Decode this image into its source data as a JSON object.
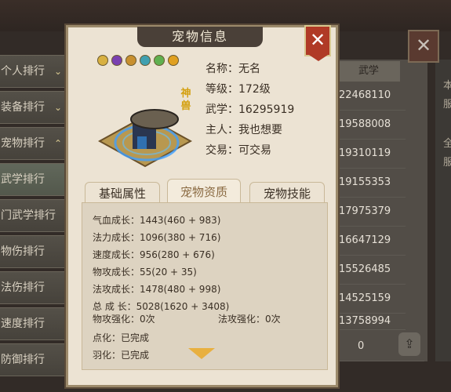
{
  "background_panel": {
    "ranking_items": [
      {
        "label": "个人排行",
        "chevron": "⌄"
      },
      {
        "label": "装备排行",
        "chevron": "⌄"
      },
      {
        "label": "宠物排行",
        "chevron": "⌃"
      },
      {
        "label": "武学排行",
        "chevron": ""
      },
      {
        "label": "门武学排行",
        "chevron": ""
      },
      {
        "label": "物伤排行",
        "chevron": ""
      },
      {
        "label": "法伤排行",
        "chevron": ""
      },
      {
        "label": "速度排行",
        "chevron": ""
      },
      {
        "label": "防御排行",
        "chevron": ""
      }
    ],
    "table_header": "武学",
    "table_values": [
      "22468110",
      "19588008",
      "19310119",
      "19155353",
      "17975379",
      "16647129",
      "15526485",
      "14525159",
      "13758994",
      "0"
    ],
    "right_edge_text": [
      "本",
      "服",
      "全",
      "服"
    ],
    "close_icon": "✕"
  },
  "dialog": {
    "title": "宠物信息",
    "close_icon": "✕",
    "pet_tag": "神兽",
    "info": {
      "name": "名称：无名",
      "level": "等级：172级",
      "martial": "武学：16295919",
      "owner": "主人：我也想要",
      "trade": "交易：可交易"
    },
    "tabs": [
      "基础属性",
      "宠物资质",
      "宠物技能"
    ],
    "active_tab": "宠物资质",
    "stats": [
      "气血成长：1443(460 + 983)",
      "法力成长：1096(380 + 716)",
      "速度成长：956(280 + 676)",
      "物攻成长：55(20 + 35)",
      "法攻成长：1478(480 + 998)",
      "总 成 长：5028(1620 + 3408)"
    ],
    "phys_enhance": "物攻强化：0次",
    "magic_enhance": "法攻强化：0次",
    "dianhua": "点化：已完成",
    "yuhua": "羽化：已完成"
  },
  "colors": {
    "accent_gold": "#e8b040",
    "close_red": "#b03a26",
    "parchment": "#ece3d3"
  }
}
